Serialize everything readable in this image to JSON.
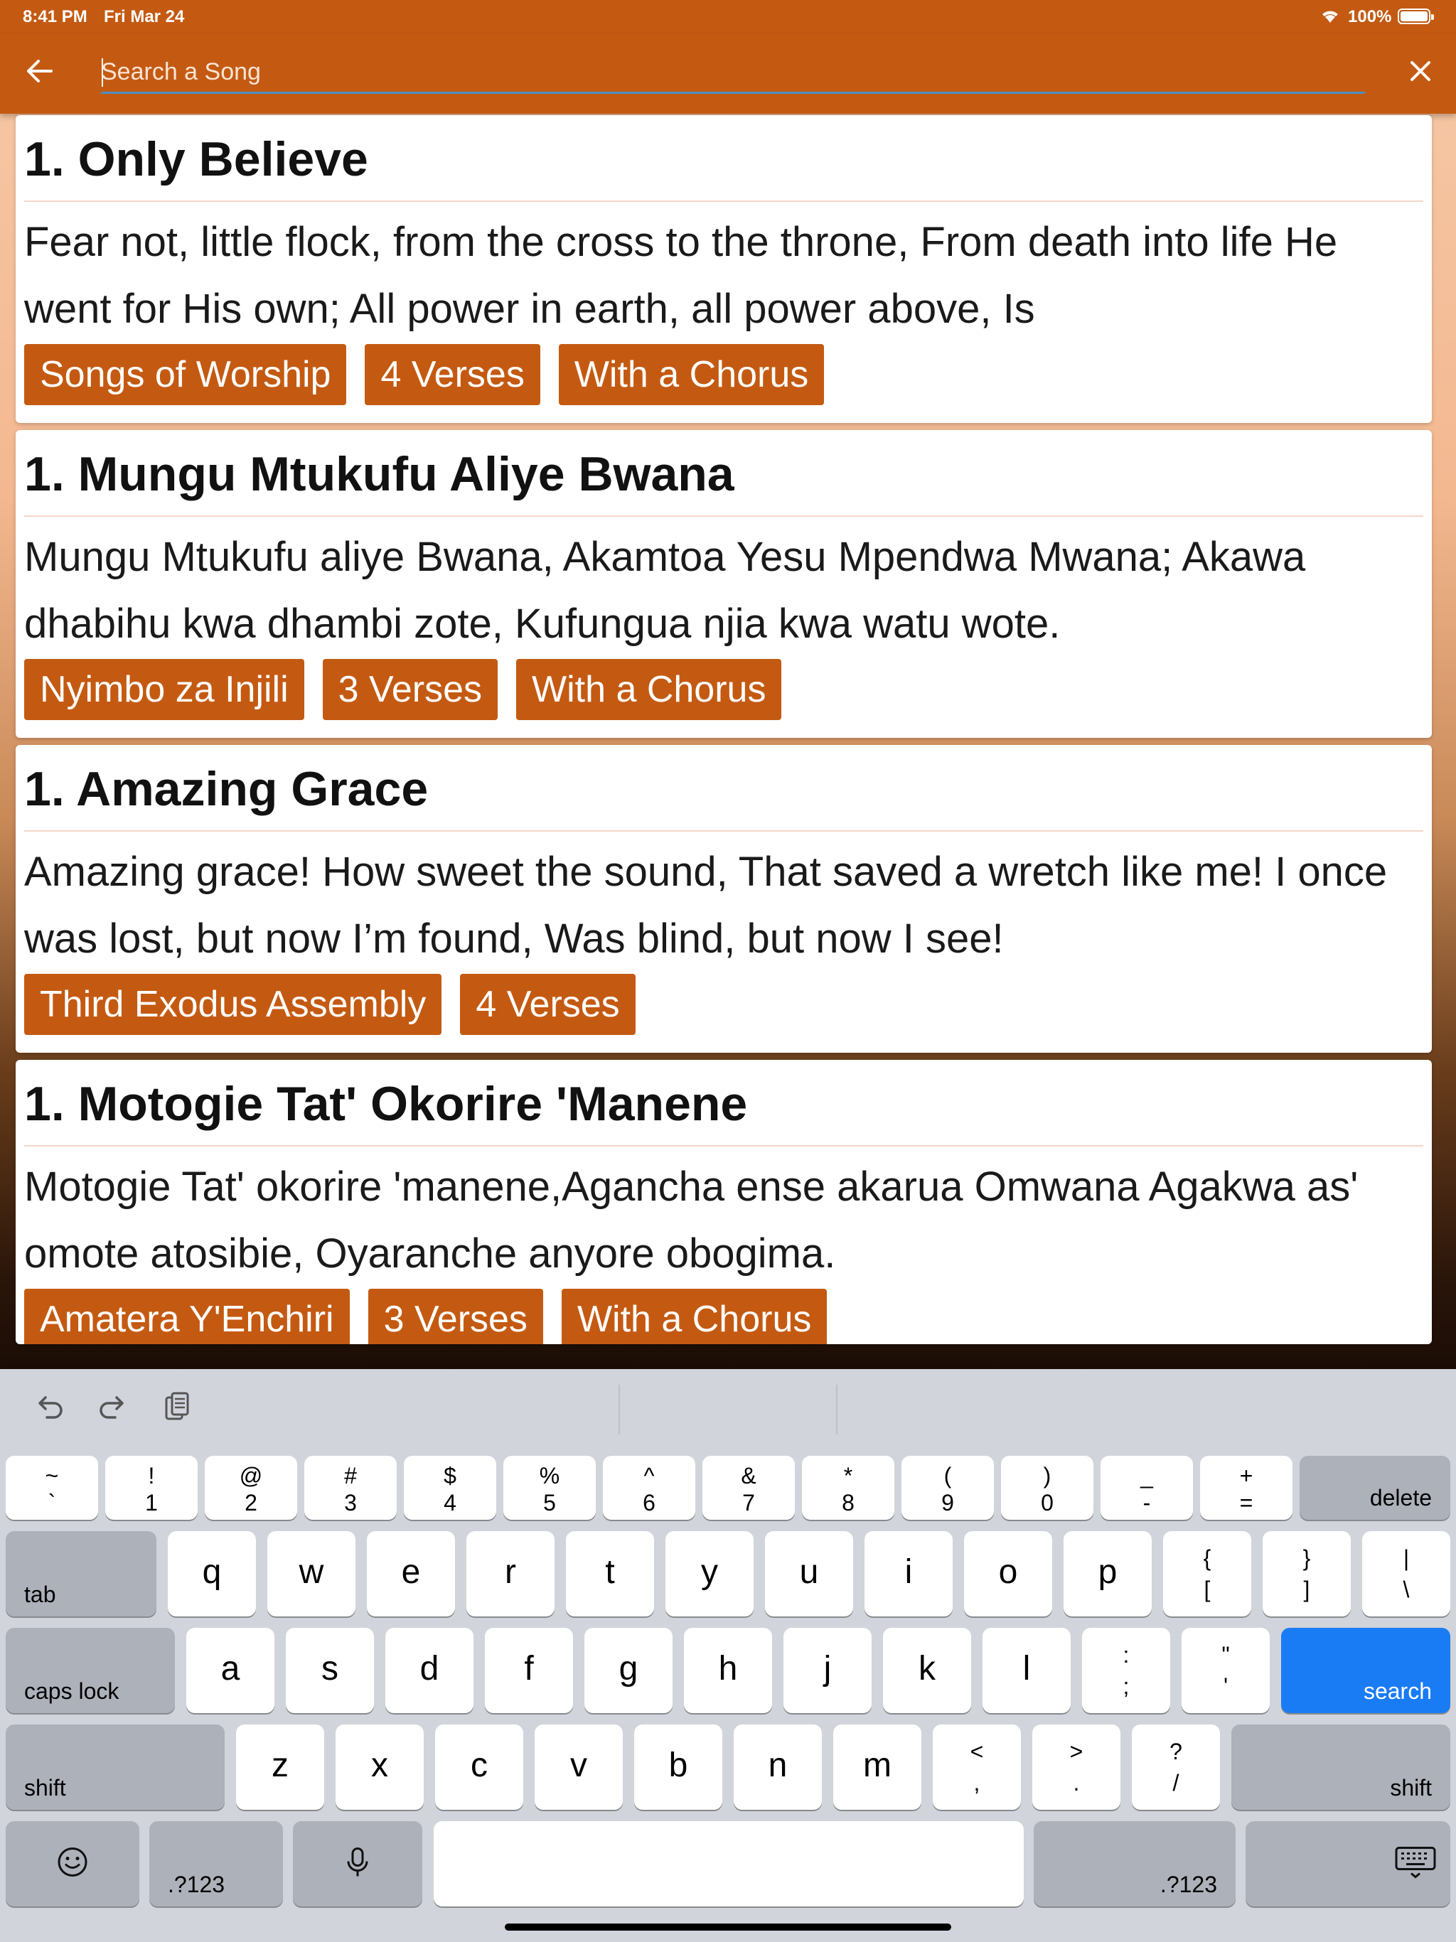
{
  "status_bar": {
    "time": "8:41 PM",
    "date": "Fri Mar 24",
    "battery": "100%"
  },
  "search": {
    "placeholder": "Search a Song",
    "value": ""
  },
  "songs": [
    {
      "title": "1. Only Believe",
      "excerpt": "Fear not, little flock, from the cross to the throne, From death into life He went for His own; All power in earth, all power above, Is",
      "tags": [
        "Songs of Worship",
        "4 Verses",
        "With a Chorus"
      ]
    },
    {
      "title": "1. Mungu Mtukufu Aliye Bwana",
      "excerpt": "Mungu Mtukufu aliye Bwana, Akamtoa Yesu Mpendwa Mwana; Akawa dhabihu kwa dhambi zote, Kufungua njia kwa watu wote.",
      "tags": [
        "Nyimbo za Injili",
        "3 Verses",
        "With a Chorus"
      ]
    },
    {
      "title": "1. Amazing Grace",
      "excerpt": "Amazing grace! How sweet the sound, That saved a wretch like me! I once was lost, but now I’m found, Was blind, but now I see!",
      "tags": [
        "Third Exodus Assembly",
        "4 Verses"
      ]
    },
    {
      "title": "1. Motogie Tat' Okorire 'Manene",
      "excerpt": "Motogie Tat' okorire 'manene,Agancha ense akarua Omwana Agakwa as' omote atosibie, Oyaranche anyore obogima.",
      "tags": [
        "Amatera Y'Enchiri",
        "3 Verses",
        "With a Chorus"
      ]
    }
  ],
  "keyboard": {
    "row1": [
      {
        "top": "~",
        "bot": "`"
      },
      {
        "top": "!",
        "bot": "1"
      },
      {
        "top": "@",
        "bot": "2"
      },
      {
        "top": "#",
        "bot": "3"
      },
      {
        "top": "$",
        "bot": "4"
      },
      {
        "top": "%",
        "bot": "5"
      },
      {
        "top": "^",
        "bot": "6"
      },
      {
        "top": "&",
        "bot": "7"
      },
      {
        "top": "*",
        "bot": "8"
      },
      {
        "top": "(",
        "bot": "9"
      },
      {
        "top": ")",
        "bot": "0"
      },
      {
        "top": "_",
        "bot": "-"
      },
      {
        "top": "+",
        "bot": "="
      }
    ],
    "delete": "delete",
    "tab": "tab",
    "row2": [
      "q",
      "w",
      "e",
      "r",
      "t",
      "y",
      "u",
      "i",
      "o",
      "p"
    ],
    "row2_sym": [
      {
        "top": "{",
        "bot": "["
      },
      {
        "top": "}",
        "bot": "]"
      },
      {
        "top": "|",
        "bot": "\\"
      }
    ],
    "caps_lock": "caps lock",
    "row3": [
      "a",
      "s",
      "d",
      "f",
      "g",
      "h",
      "j",
      "k",
      "l"
    ],
    "row3_sym": [
      {
        "top": ":",
        "bot": ";"
      },
      {
        "top": "\"",
        "bot": "'"
      }
    ],
    "search_key": "search",
    "shift_left": "shift",
    "row4": [
      "z",
      "x",
      "c",
      "v",
      "b",
      "n",
      "m"
    ],
    "row4_sym": [
      {
        "top": "<",
        "bot": ","
      },
      {
        "top": ">",
        "bot": "."
      },
      {
        "top": "?",
        "bot": "/"
      }
    ],
    "shift_right": "shift",
    "numbers_left": ".?123",
    "numbers_right": ".?123"
  }
}
